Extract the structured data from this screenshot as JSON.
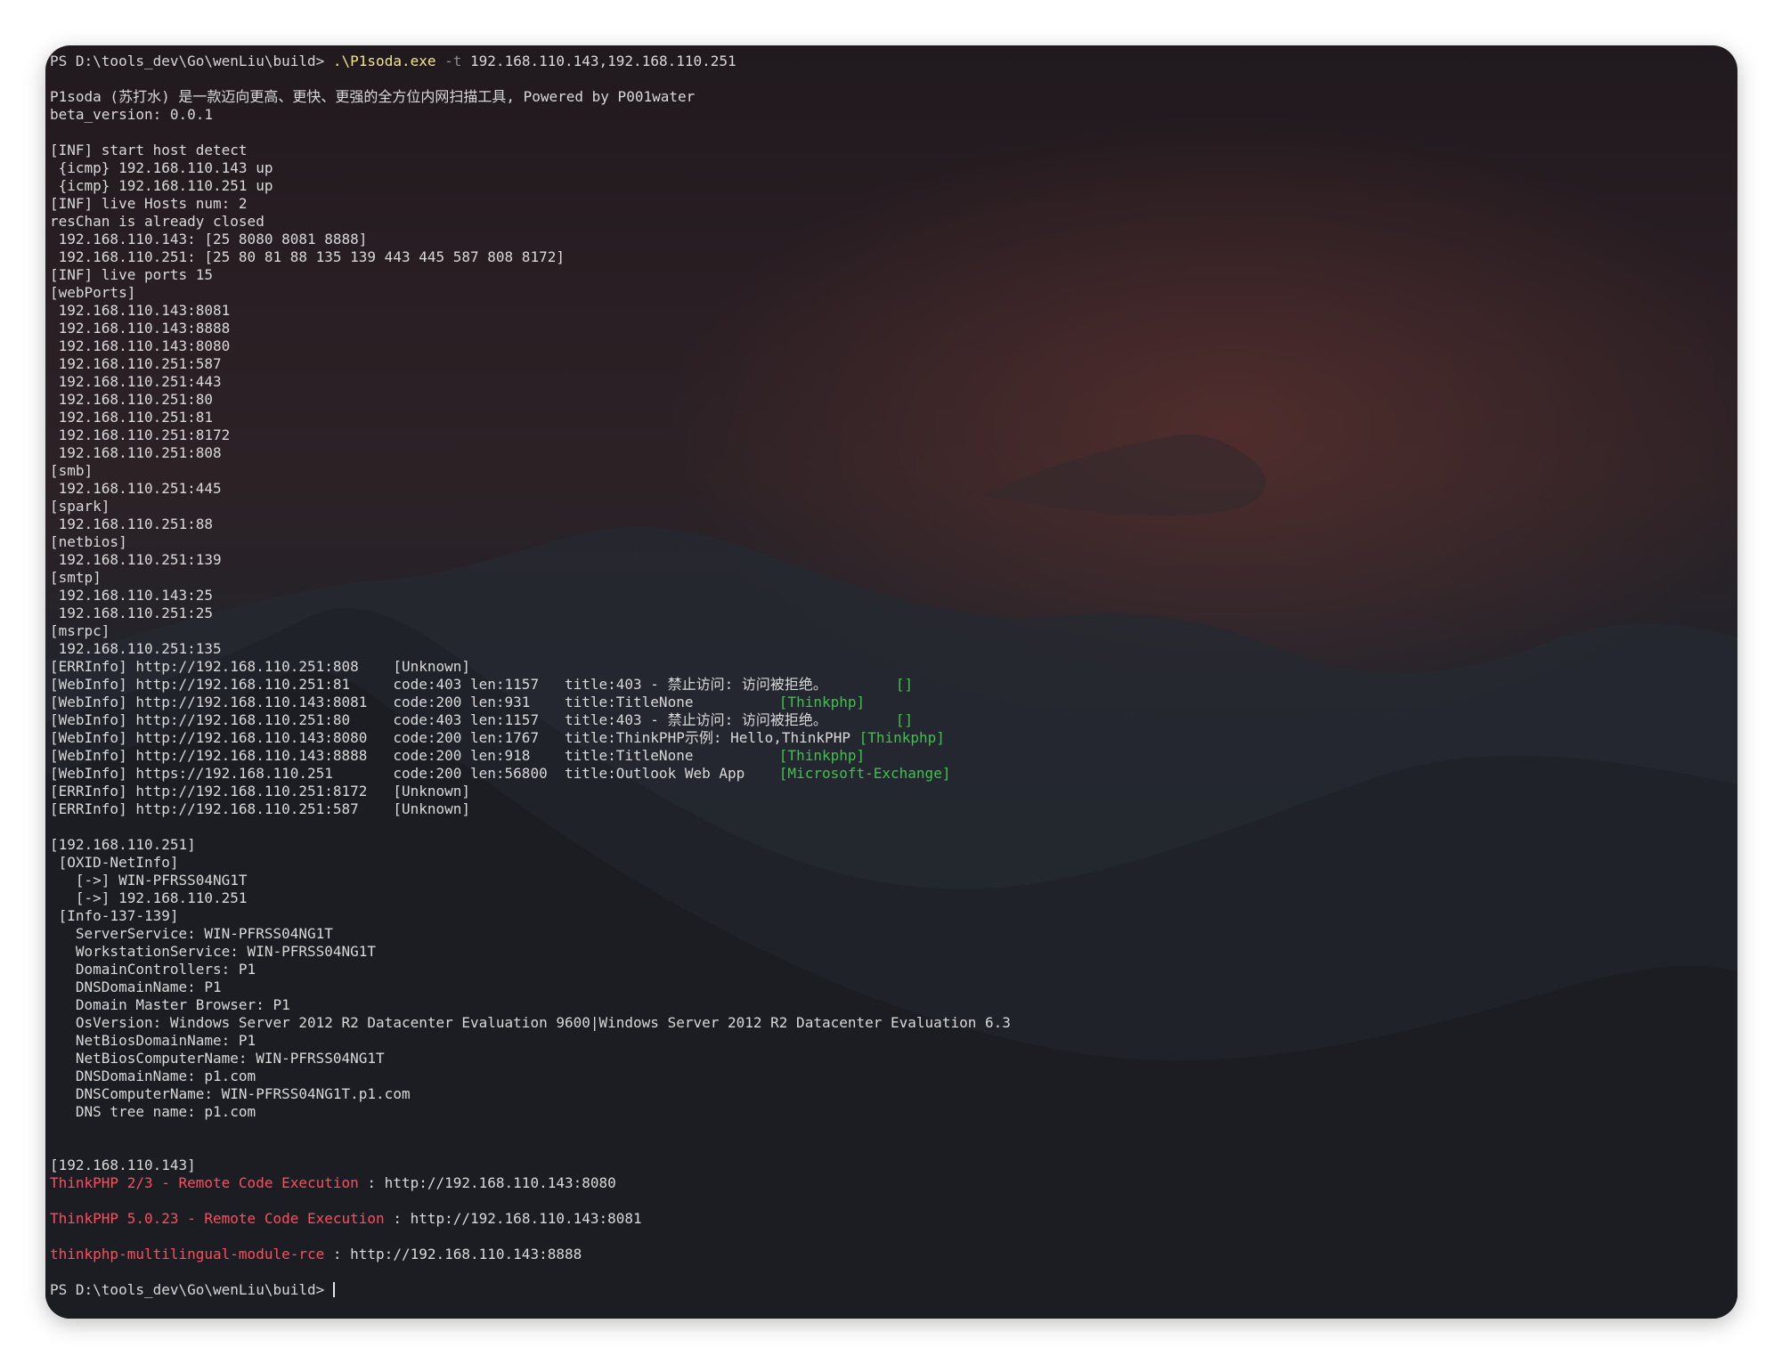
{
  "colors": {
    "text": "#d9d9d9",
    "exe": "#f2e58a",
    "flag": "#8a8a8a",
    "green": "#3fc24b",
    "red": "#ff4d5e"
  },
  "terminal": {
    "prompt": "PS D:\\tools_dev\\Go\\wenLiu\\build>",
    "command": {
      "exe": ".\\P1soda.exe",
      "flag": "-t",
      "args": "192.168.110.143,192.168.110.251"
    },
    "banner": [
      "P1soda (苏打水) 是一款迈向更高、更快、更强的全方位内网扫描工具, Powered by P001water",
      "beta_version: 0.0.1"
    ],
    "host_detect": [
      "[INF] start host detect",
      " {icmp} 192.168.110.143 up",
      " {icmp} 192.168.110.251 up",
      "[INF] live Hosts num: 2",
      "resChan is already closed",
      " 192.168.110.143: [25 8080 8081 8888]",
      " 192.168.110.251: [25 80 81 88 135 139 443 445 587 808 8172]",
      "[INF] live ports 15",
      "[webPorts]",
      " 192.168.110.143:8081",
      " 192.168.110.143:8888",
      " 192.168.110.143:8080",
      " 192.168.110.251:587",
      " 192.168.110.251:443",
      " 192.168.110.251:80",
      " 192.168.110.251:81",
      " 192.168.110.251:8172",
      " 192.168.110.251:808",
      "[smb]",
      " 192.168.110.251:445",
      "[spark]",
      " 192.168.110.251:88",
      "[netbios]",
      " 192.168.110.251:139",
      "[smtp]",
      " 192.168.110.143:25",
      " 192.168.110.251:25",
      "[msrpc]",
      " 192.168.110.251:135"
    ],
    "web_info": [
      {
        "text": "[ERRInfo] http://192.168.110.251:808    [Unknown]",
        "tag": ""
      },
      {
        "text": "[WebInfo] http://192.168.110.251:81     code:403 len:1157   title:403 - 禁止访问: 访问被拒绝。        ",
        "tag": "[]"
      },
      {
        "text": "[WebInfo] http://192.168.110.143:8081   code:200 len:931    title:TitleNone          ",
        "tag": "[Thinkphp]"
      },
      {
        "text": "[WebInfo] http://192.168.110.251:80     code:403 len:1157   title:403 - 禁止访问: 访问被拒绝。        ",
        "tag": "[]"
      },
      {
        "text": "[WebInfo] http://192.168.110.143:8080   code:200 len:1767   title:ThinkPHP示例: Hello,ThinkPHP ",
        "tag": "[Thinkphp]"
      },
      {
        "text": "[WebInfo] http://192.168.110.143:8888   code:200 len:918    title:TitleNone          ",
        "tag": "[Thinkphp]"
      },
      {
        "text": "[WebInfo] https://192.168.110.251       code:200 len:56800  title:Outlook Web App    ",
        "tag": "[Microsoft-Exchange]"
      },
      {
        "text": "[ERRInfo] http://192.168.110.251:8172   [Unknown]",
        "tag": ""
      },
      {
        "text": "[ERRInfo] http://192.168.110.251:587    [Unknown]",
        "tag": ""
      }
    ],
    "host_251": [
      "[192.168.110.251]",
      " [OXID-NetInfo]",
      "   [->] WIN-PFRSS04NG1T",
      "   [->] 192.168.110.251",
      " [Info-137-139]",
      "   ServerService: WIN-PFRSS04NG1T",
      "   WorkstationService: WIN-PFRSS04NG1T",
      "   DomainControllers: P1",
      "   DNSDomainName: P1",
      "   Domain Master Browser: P1",
      "   OsVersion: Windows Server 2012 R2 Datacenter Evaluation 9600|Windows Server 2012 R2 Datacenter Evaluation 6.3",
      "   NetBiosDomainName: P1",
      "   NetBiosComputerName: WIN-PFRSS04NG1T",
      "   DNSDomainName: p1.com",
      "   DNSComputerName: WIN-PFRSS04NG1T.p1.com",
      "   DNS tree name: p1.com"
    ],
    "host_143_header": "[192.168.110.143]",
    "vulns": [
      {
        "name": "ThinkPHP 2/3 - Remote Code Execution",
        "rest": " : http://192.168.110.143:8080"
      },
      {
        "name": "ThinkPHP 5.0.23 - Remote Code Execution",
        "rest": " : http://192.168.110.143:8081"
      },
      {
        "name": "thinkphp-multilingual-module-rce",
        "rest": " : http://192.168.110.143:8888"
      }
    ]
  }
}
